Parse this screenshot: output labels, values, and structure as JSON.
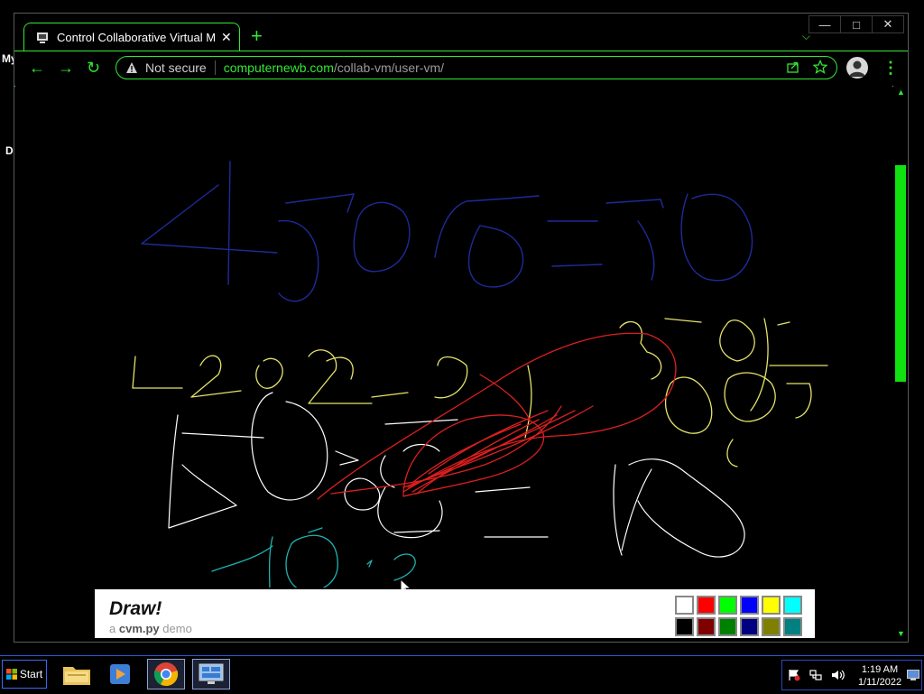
{
  "desktop": {
    "labels": [
      "My",
      "D"
    ]
  },
  "browser": {
    "tab_title": "Control Collaborative Virtual Mac",
    "new_tab_label": "+",
    "security_label": "Not secure",
    "url_host": "computernewb.com",
    "url_path": "/collab-vm/user-vm/",
    "accent_color": "#33e833"
  },
  "draw_panel": {
    "title": "Draw!",
    "subtitle_prefix": "a",
    "subtitle_name": "cvm.py",
    "subtitle_suffix": "demo",
    "palette": [
      "#ffffff",
      "#ff0000",
      "#00ff00",
      "#0000ff",
      "#ffff00",
      "#00ffff",
      "#000000",
      "#800000",
      "#008000",
      "#000080",
      "#808000",
      "#008080"
    ]
  },
  "taskbar": {
    "start_label": "Start",
    "apps": [
      "windows-explorer-icon",
      "media-player-icon",
      "chrome-icon",
      "remote-desktop-icon"
    ],
    "time": "1:19 AM",
    "date": "1/11/2022"
  }
}
